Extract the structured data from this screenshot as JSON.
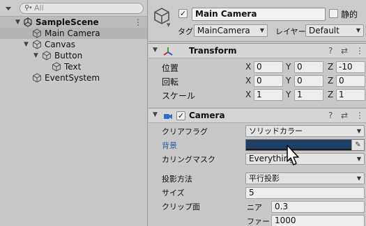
{
  "hierarchy": {
    "search_placeholder": "All",
    "scene_name": "SampleScene",
    "scene_menu": "⋮",
    "items": [
      {
        "label": "Main Camera"
      },
      {
        "label": "Canvas"
      },
      {
        "label": "Button"
      },
      {
        "label": "Text"
      },
      {
        "label": "EventSystem"
      }
    ]
  },
  "inspector": {
    "object_name": "Main Camera",
    "active_check": "✓",
    "static_label": "静的",
    "tag_label": "タグ",
    "tag_value": "MainCamera",
    "layer_label": "レイヤー",
    "layer_value": "Default",
    "transform": {
      "title": "Transform",
      "position_label": "位置",
      "rotation_label": "回転",
      "scale_label": "スケール",
      "axis_x": "X",
      "axis_y": "Y",
      "axis_z": "Z",
      "position": {
        "x": "0",
        "y": "0",
        "z": "-10"
      },
      "rotation": {
        "x": "0",
        "y": "0",
        "z": "0"
      },
      "scale": {
        "x": "1",
        "y": "1",
        "z": "1"
      }
    },
    "camera": {
      "title": "Camera",
      "enabled_check": "✓",
      "clear_flags_label": "クリアフラグ",
      "clear_flags_value": "ソリッドカラー",
      "background_label": "背景",
      "background_color": "#1e3f66",
      "culling_mask_label": "カリングマスク",
      "culling_mask_value": "Everything",
      "projection_label": "投影方法",
      "projection_value": "平行投影",
      "size_label": "サイズ",
      "size_value": "5",
      "clipping_label": "クリップ面",
      "near_label": "ニア",
      "near_value": "0.3",
      "far_label": "ファー",
      "far_value": "1000"
    },
    "help_icon": "?",
    "settings_icon": "⇄",
    "menu_icon": "⋮"
  }
}
